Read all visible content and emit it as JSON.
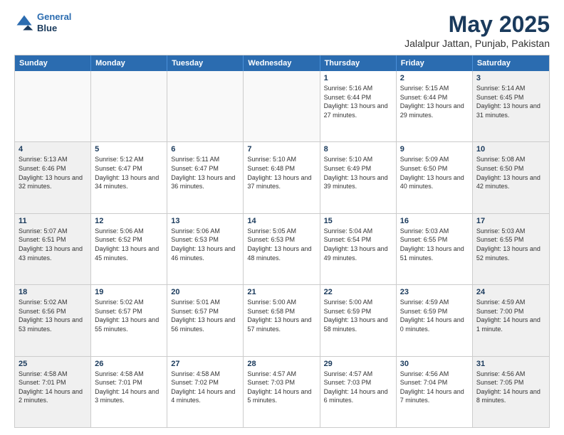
{
  "header": {
    "logo": {
      "line1": "General",
      "line2": "Blue"
    },
    "title": "May 2025",
    "subtitle": "Jalalpur Jattan, Punjab, Pakistan"
  },
  "dayHeaders": [
    "Sunday",
    "Monday",
    "Tuesday",
    "Wednesday",
    "Thursday",
    "Friday",
    "Saturday"
  ],
  "rows": [
    [
      {
        "day": "",
        "empty": true
      },
      {
        "day": "",
        "empty": true
      },
      {
        "day": "",
        "empty": true
      },
      {
        "day": "",
        "empty": true
      },
      {
        "day": "1",
        "sunrise": "5:16 AM",
        "sunset": "6:44 PM",
        "daylight": "13 hours and 27 minutes."
      },
      {
        "day": "2",
        "sunrise": "5:15 AM",
        "sunset": "6:44 PM",
        "daylight": "13 hours and 29 minutes."
      },
      {
        "day": "3",
        "sunrise": "5:14 AM",
        "sunset": "6:45 PM",
        "daylight": "13 hours and 31 minutes."
      }
    ],
    [
      {
        "day": "4",
        "sunrise": "5:13 AM",
        "sunset": "6:46 PM",
        "daylight": "13 hours and 32 minutes."
      },
      {
        "day": "5",
        "sunrise": "5:12 AM",
        "sunset": "6:47 PM",
        "daylight": "13 hours and 34 minutes."
      },
      {
        "day": "6",
        "sunrise": "5:11 AM",
        "sunset": "6:47 PM",
        "daylight": "13 hours and 36 minutes."
      },
      {
        "day": "7",
        "sunrise": "5:10 AM",
        "sunset": "6:48 PM",
        "daylight": "13 hours and 37 minutes."
      },
      {
        "day": "8",
        "sunrise": "5:10 AM",
        "sunset": "6:49 PM",
        "daylight": "13 hours and 39 minutes."
      },
      {
        "day": "9",
        "sunrise": "5:09 AM",
        "sunset": "6:50 PM",
        "daylight": "13 hours and 40 minutes."
      },
      {
        "day": "10",
        "sunrise": "5:08 AM",
        "sunset": "6:50 PM",
        "daylight": "13 hours and 42 minutes."
      }
    ],
    [
      {
        "day": "11",
        "sunrise": "5:07 AM",
        "sunset": "6:51 PM",
        "daylight": "13 hours and 43 minutes."
      },
      {
        "day": "12",
        "sunrise": "5:06 AM",
        "sunset": "6:52 PM",
        "daylight": "13 hours and 45 minutes."
      },
      {
        "day": "13",
        "sunrise": "5:06 AM",
        "sunset": "6:53 PM",
        "daylight": "13 hours and 46 minutes."
      },
      {
        "day": "14",
        "sunrise": "5:05 AM",
        "sunset": "6:53 PM",
        "daylight": "13 hours and 48 minutes."
      },
      {
        "day": "15",
        "sunrise": "5:04 AM",
        "sunset": "6:54 PM",
        "daylight": "13 hours and 49 minutes."
      },
      {
        "day": "16",
        "sunrise": "5:03 AM",
        "sunset": "6:55 PM",
        "daylight": "13 hours and 51 minutes."
      },
      {
        "day": "17",
        "sunrise": "5:03 AM",
        "sunset": "6:55 PM",
        "daylight": "13 hours and 52 minutes."
      }
    ],
    [
      {
        "day": "18",
        "sunrise": "5:02 AM",
        "sunset": "6:56 PM",
        "daylight": "13 hours and 53 minutes."
      },
      {
        "day": "19",
        "sunrise": "5:02 AM",
        "sunset": "6:57 PM",
        "daylight": "13 hours and 55 minutes."
      },
      {
        "day": "20",
        "sunrise": "5:01 AM",
        "sunset": "6:57 PM",
        "daylight": "13 hours and 56 minutes."
      },
      {
        "day": "21",
        "sunrise": "5:00 AM",
        "sunset": "6:58 PM",
        "daylight": "13 hours and 57 minutes."
      },
      {
        "day": "22",
        "sunrise": "5:00 AM",
        "sunset": "6:59 PM",
        "daylight": "13 hours and 58 minutes."
      },
      {
        "day": "23",
        "sunrise": "4:59 AM",
        "sunset": "6:59 PM",
        "daylight": "14 hours and 0 minutes."
      },
      {
        "day": "24",
        "sunrise": "4:59 AM",
        "sunset": "7:00 PM",
        "daylight": "14 hours and 1 minute."
      }
    ],
    [
      {
        "day": "25",
        "sunrise": "4:58 AM",
        "sunset": "7:01 PM",
        "daylight": "14 hours and 2 minutes."
      },
      {
        "day": "26",
        "sunrise": "4:58 AM",
        "sunset": "7:01 PM",
        "daylight": "14 hours and 3 minutes."
      },
      {
        "day": "27",
        "sunrise": "4:58 AM",
        "sunset": "7:02 PM",
        "daylight": "14 hours and 4 minutes."
      },
      {
        "day": "28",
        "sunrise": "4:57 AM",
        "sunset": "7:03 PM",
        "daylight": "14 hours and 5 minutes."
      },
      {
        "day": "29",
        "sunrise": "4:57 AM",
        "sunset": "7:03 PM",
        "daylight": "14 hours and 6 minutes."
      },
      {
        "day": "30",
        "sunrise": "4:56 AM",
        "sunset": "7:04 PM",
        "daylight": "14 hours and 7 minutes."
      },
      {
        "day": "31",
        "sunrise": "4:56 AM",
        "sunset": "7:05 PM",
        "daylight": "14 hours and 8 minutes."
      }
    ]
  ],
  "labels": {
    "sunrise": "Sunrise:",
    "sunset": "Sunset:",
    "daylight": "Daylight:"
  },
  "colors": {
    "header_bg": "#2b6cb0",
    "shaded_bg": "#f0f0f0",
    "empty_bg": "#f9f9f9",
    "day_color": "#1a3a5c"
  }
}
